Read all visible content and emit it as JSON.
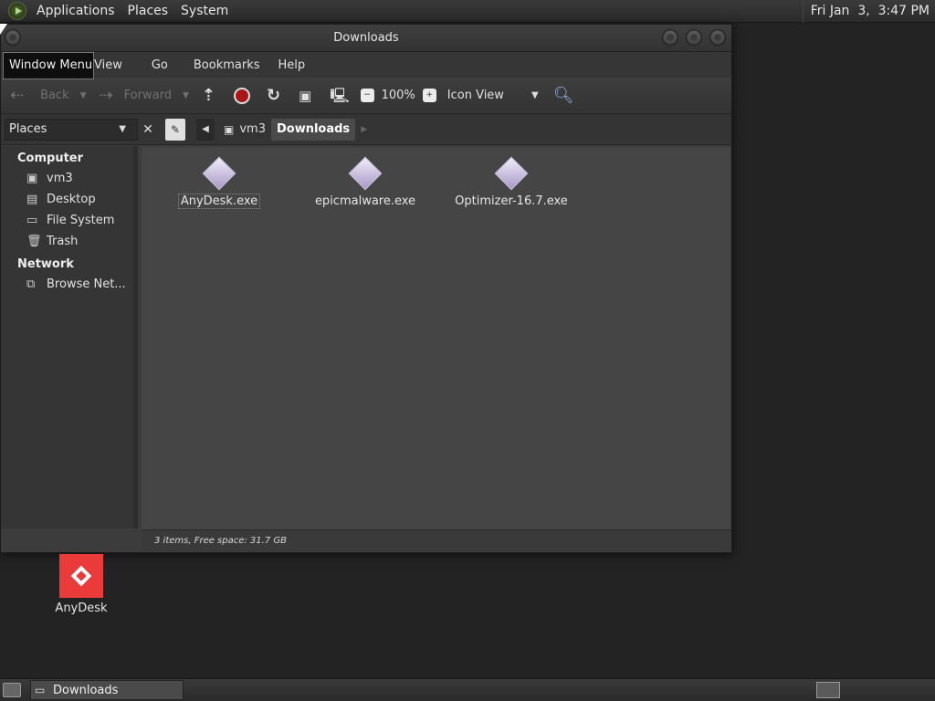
{
  "top_panel": {
    "menus": [
      "Applications",
      "Places",
      "System"
    ],
    "clock": "Fri Jan  3,  3:47 PM"
  },
  "window": {
    "title": "Downloads",
    "tooltip": "Window Menu",
    "menubar": [
      "View",
      "Go",
      "Bookmarks",
      "Help"
    ],
    "toolbar": {
      "back": "Back",
      "forward": "Forward",
      "zoom": "100%",
      "view_mode": "Icon View"
    },
    "location": {
      "places_label": "Places",
      "crumbs": [
        "vm3",
        "Downloads"
      ]
    },
    "sidebar": {
      "sections": [
        {
          "title": "Computer",
          "items": [
            {
              "label": "vm3",
              "icon": "home-folder-icon"
            },
            {
              "label": "Desktop",
              "icon": "desktop-folder-icon"
            },
            {
              "label": "File System",
              "icon": "drive-icon"
            },
            {
              "label": "Trash",
              "icon": "trash-icon"
            }
          ]
        },
        {
          "title": "Network",
          "items": [
            {
              "label": "Browse Net...",
              "icon": "network-icon"
            }
          ]
        }
      ]
    },
    "files": [
      {
        "name": "AnyDesk.exe"
      },
      {
        "name": "epicmalware.exe"
      },
      {
        "name": "Optimizer-16.7.exe"
      }
    ],
    "status": "3 items, Free space: 31.7 GB"
  },
  "desktop": {
    "icons": [
      {
        "label": "AnyDesk"
      }
    ]
  },
  "bottom_panel": {
    "task_label": "Downloads"
  }
}
